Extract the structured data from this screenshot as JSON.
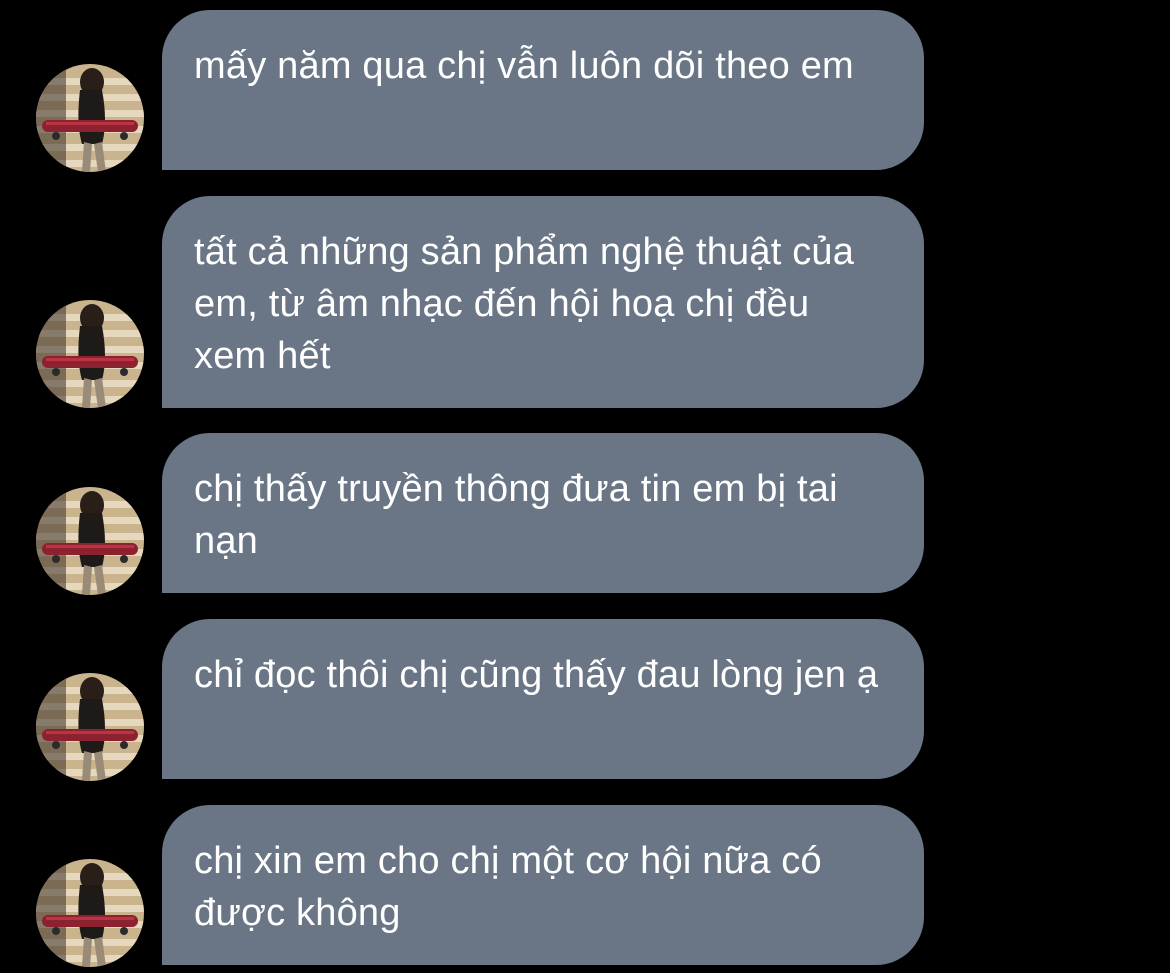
{
  "conversation": {
    "messages": [
      {
        "text": "mấy năm qua chị vẫn luôn dõi theo em"
      },
      {
        "text": "tất cả những sản phẩm nghệ thuật của em, từ âm nhạc đến hội hoạ chị đều xem hết"
      },
      {
        "text": "chị thấy truyền thông đưa tin em bị tai nạn"
      },
      {
        "text": "chỉ đọc thôi chị cũng thấy đau lòng jen ạ"
      },
      {
        "text": "chị xin em cho chị một cơ hội nữa có được không"
      }
    ]
  },
  "colors": {
    "background": "#000000",
    "bubble": "#6a7686",
    "text": "#ffffff"
  },
  "icons": {
    "sender_avatar": "profile-photo-avatar"
  }
}
